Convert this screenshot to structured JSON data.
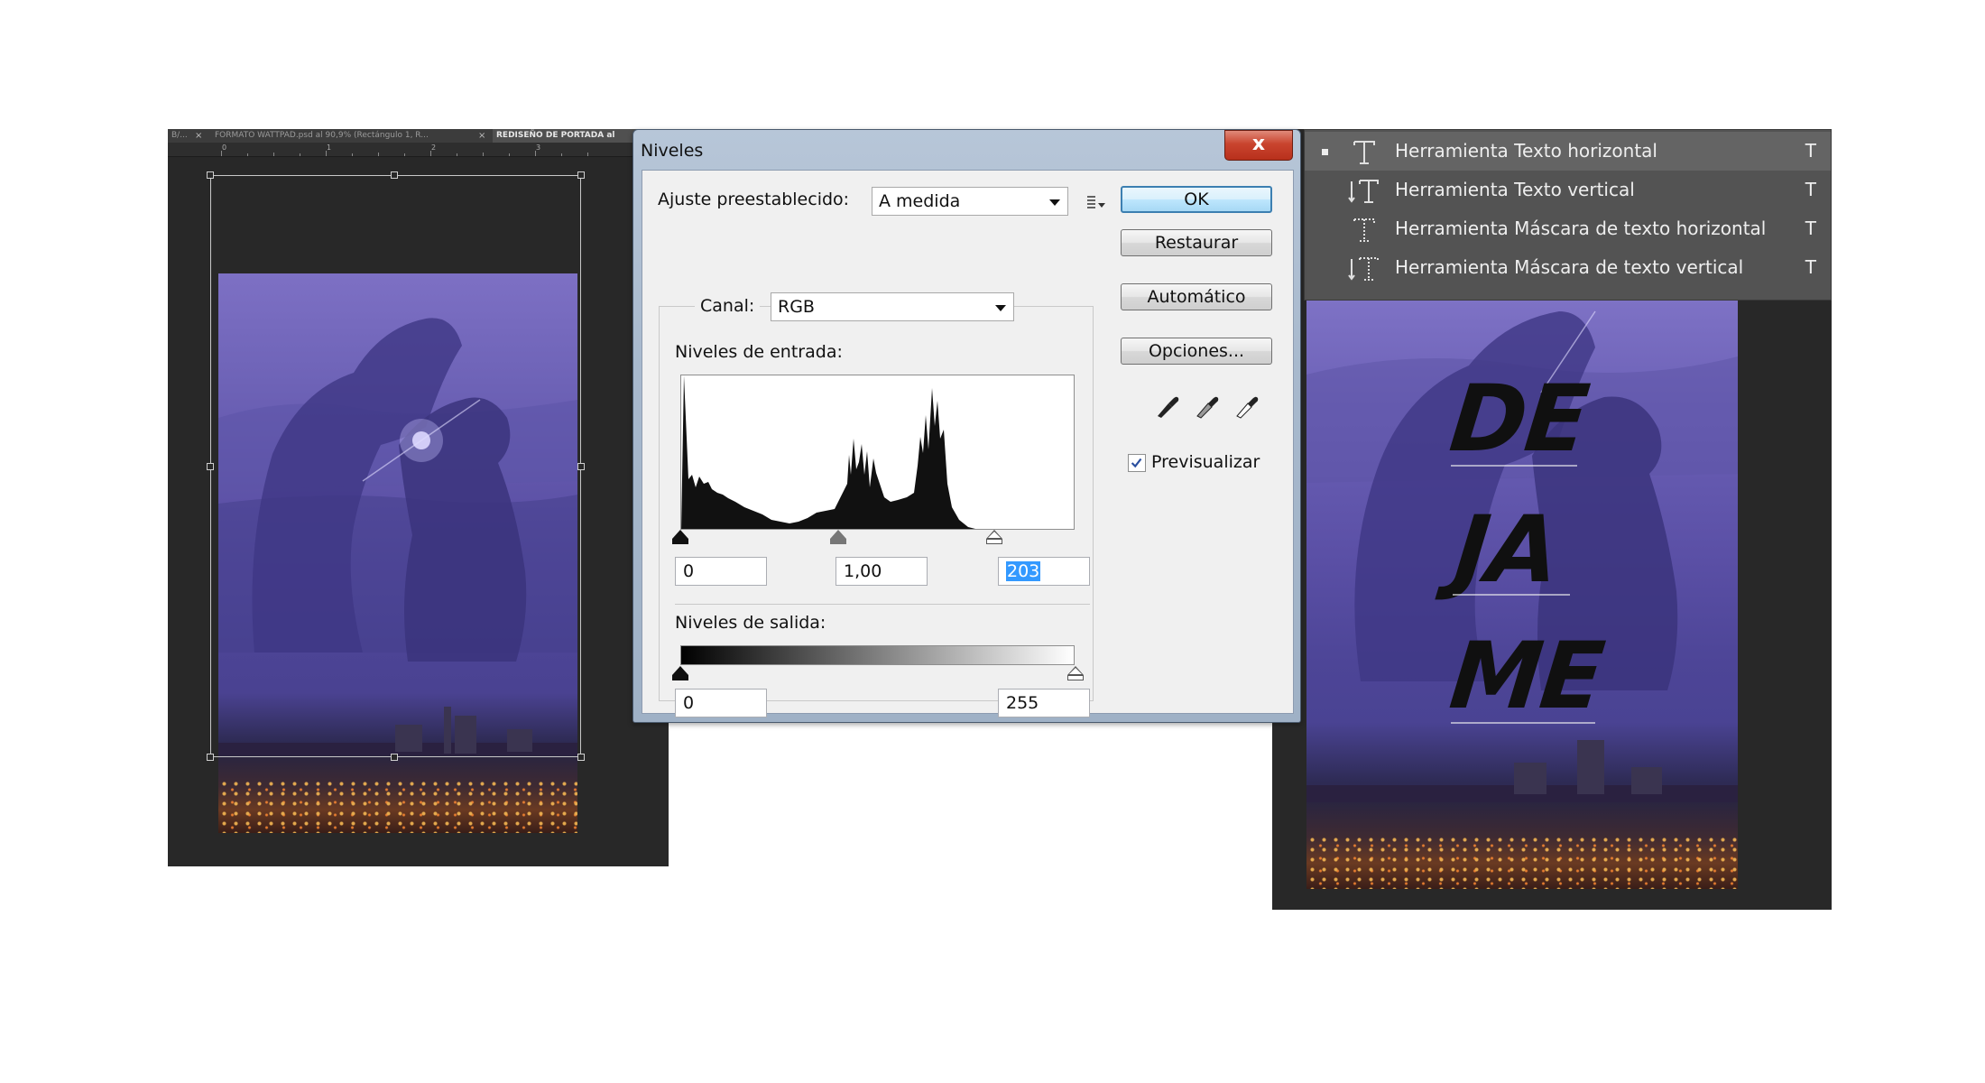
{
  "left": {
    "tabs": [
      {
        "label": "B/..."
      },
      {
        "label": "FORMATO WATTPAD.psd al 90,9% (Rectángulo 1, R..."
      },
      {
        "label": "REDISEÑO DE PORTADA al"
      }
    ],
    "tab_close": "×",
    "ruler_labels": [
      "0",
      "1",
      "2",
      "3"
    ]
  },
  "dialog": {
    "title": "Niveles",
    "close": "x",
    "preset_label": "Ajuste preestablecido:",
    "preset_value": "A medida",
    "channel_label": "Canal:",
    "channel_value": "RGB",
    "input_levels_label": "Niveles de entrada:",
    "input_black": "0",
    "input_gamma": "1,00",
    "input_white": "203",
    "output_levels_label": "Niveles de salida:",
    "output_black": "0",
    "output_white": "255",
    "buttons": {
      "ok": "OK",
      "reset": "Restaurar",
      "auto": "Automático",
      "options": "Opciones..."
    },
    "preview_label": "Previsualizar",
    "preview_checked": true,
    "histogram_slider_positions": {
      "black": 0,
      "gamma": 1.0,
      "white": 203,
      "max": 255
    }
  },
  "tool_menu": {
    "items": [
      {
        "label": "Herramienta Texto horizontal",
        "key": "T",
        "active": true,
        "icon": "horizontal-type-icon"
      },
      {
        "label": "Herramienta Texto vertical",
        "key": "T",
        "active": false,
        "icon": "vertical-type-icon"
      },
      {
        "label": "Herramienta Máscara de texto horizontal",
        "key": "T",
        "active": false,
        "icon": "horizontal-type-mask-icon"
      },
      {
        "label": "Herramienta Máscara de texto vertical",
        "key": "T",
        "active": false,
        "icon": "vertical-type-mask-icon"
      }
    ]
  },
  "cover": {
    "lines": [
      "DE",
      "JA",
      "ME"
    ]
  },
  "colors": {
    "workspace": "#282828",
    "sky_purple": "#6f64b8",
    "dialog_frame": "#a8b9cd",
    "selection_blue": "#3399ff",
    "close_red": "#c9442e"
  }
}
